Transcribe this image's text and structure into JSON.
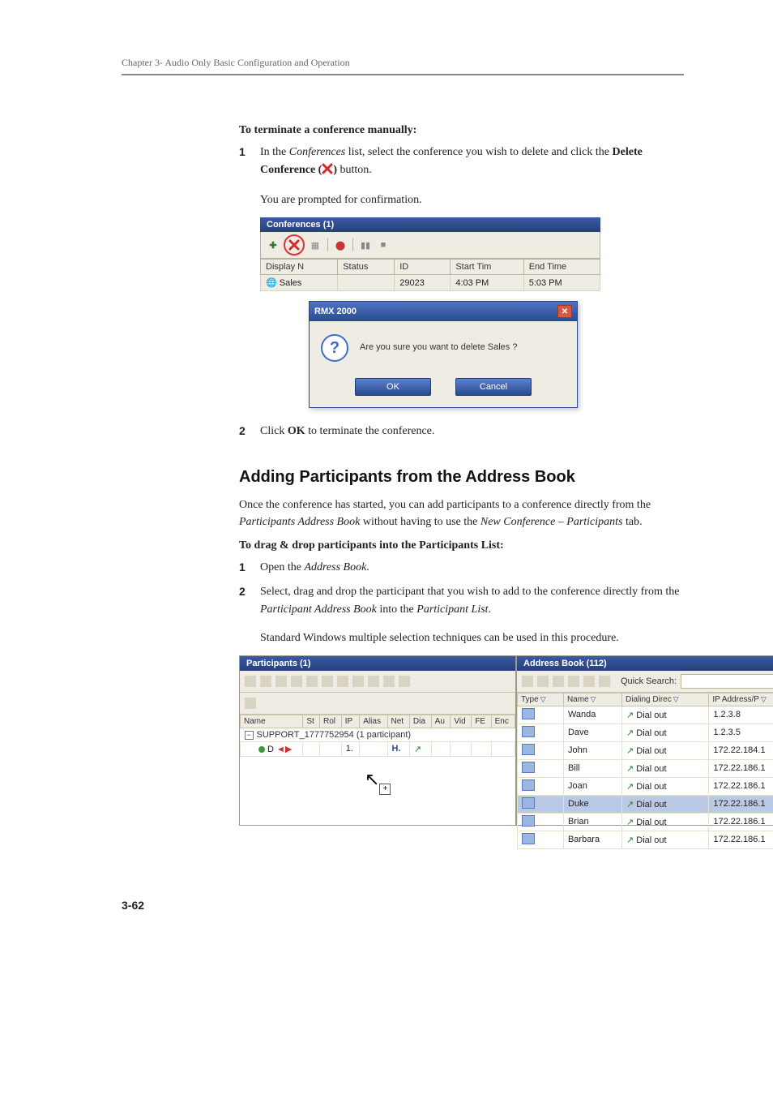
{
  "chapter": "Chapter 3- Audio Only Basic Configuration and Operation",
  "page_number": "3-62",
  "section1": {
    "heading": "To terminate a conference manually:",
    "step1_pre": "In the ",
    "step1_em": "Conferences",
    "step1_mid": " list, select the conference you wish to delete and click the ",
    "step1_bold": "Delete Conference (",
    "step1_after_icon": ")",
    "step1_tail": " button.",
    "step1_follow": "You are prompted for confirmation.",
    "step2_pre": "Click ",
    "step2_bold": "OK",
    "step2_tail": " to terminate the conference."
  },
  "shot1": {
    "title": "Conferences (1)",
    "cols": {
      "display": "Display N",
      "status": "Status",
      "id": "ID",
      "start": "Start Tim",
      "end": "End Time"
    },
    "row": {
      "name": "Sales",
      "id": "29023",
      "start": "4:03 PM",
      "end": "5:03 PM"
    },
    "dialog": {
      "title": "RMX 2000",
      "msg": "Are you sure you want to delete Sales ?",
      "ok": "OK",
      "cancel": "Cancel"
    }
  },
  "section2": {
    "h2": "Adding Participants from the Address Book",
    "intro_pre": "Once the conference has started, you can add participants to a conference directly from the ",
    "intro_em1": "Participants Address Book",
    "intro_mid": " without having to use the ",
    "intro_em2": "New Conference – Participants",
    "intro_tail": " tab.",
    "subhead": "To drag & drop participants into the Participants List:",
    "s1_pre": "Open the ",
    "s1_em": "Address Book",
    "s1_tail": ".",
    "s2_pre": "Select, drag and drop the participant that you wish to add to the conference directly from the ",
    "s2_em1": "Participant Address Book",
    "s2_mid": " into the ",
    "s2_em2": "Participant List",
    "s2_tail": ".",
    "s2_follow": "Standard Windows multiple selection techniques can be used in this procedure."
  },
  "shot2": {
    "left": {
      "title": "Participants (1)",
      "cols": [
        "Name",
        "St",
        "Rol",
        "IP",
        "Alias",
        "Net",
        "Dia",
        "Au",
        "Vid",
        "FE",
        "Enc"
      ],
      "group_pre": "SUPPORT_1777752954 (1 participant)",
      "part_name": "D",
      "part_ip": "1.",
      "part_net": "H.",
      "toggle": "−"
    },
    "right": {
      "title": "Address Book (112)",
      "quick_label": "Quick Search:",
      "cols": {
        "type": "Type",
        "name": "Name",
        "dial": "Dialing Direc",
        "ip": "IP Address/P"
      },
      "rows": [
        {
          "name": "Wanda",
          "dial": "Dial out",
          "ip": "1.2.3.8"
        },
        {
          "name": "Dave",
          "dial": "Dial out",
          "ip": "1.2.3.5"
        },
        {
          "name": "John",
          "dial": "Dial out",
          "ip": "172.22.184.1"
        },
        {
          "name": "Bill",
          "dial": "Dial out",
          "ip": "172.22.186.1"
        },
        {
          "name": "Joan",
          "dial": "Dial out",
          "ip": "172.22.186.1"
        },
        {
          "name": "Duke",
          "dial": "Dial out",
          "ip": "172.22.186.1",
          "sel": true
        },
        {
          "name": "Brian",
          "dial": "Dial out",
          "ip": "172.22.186.1"
        },
        {
          "name": "Barbara",
          "dial": "Dial out",
          "ip": "172.22.186.1"
        }
      ]
    }
  }
}
